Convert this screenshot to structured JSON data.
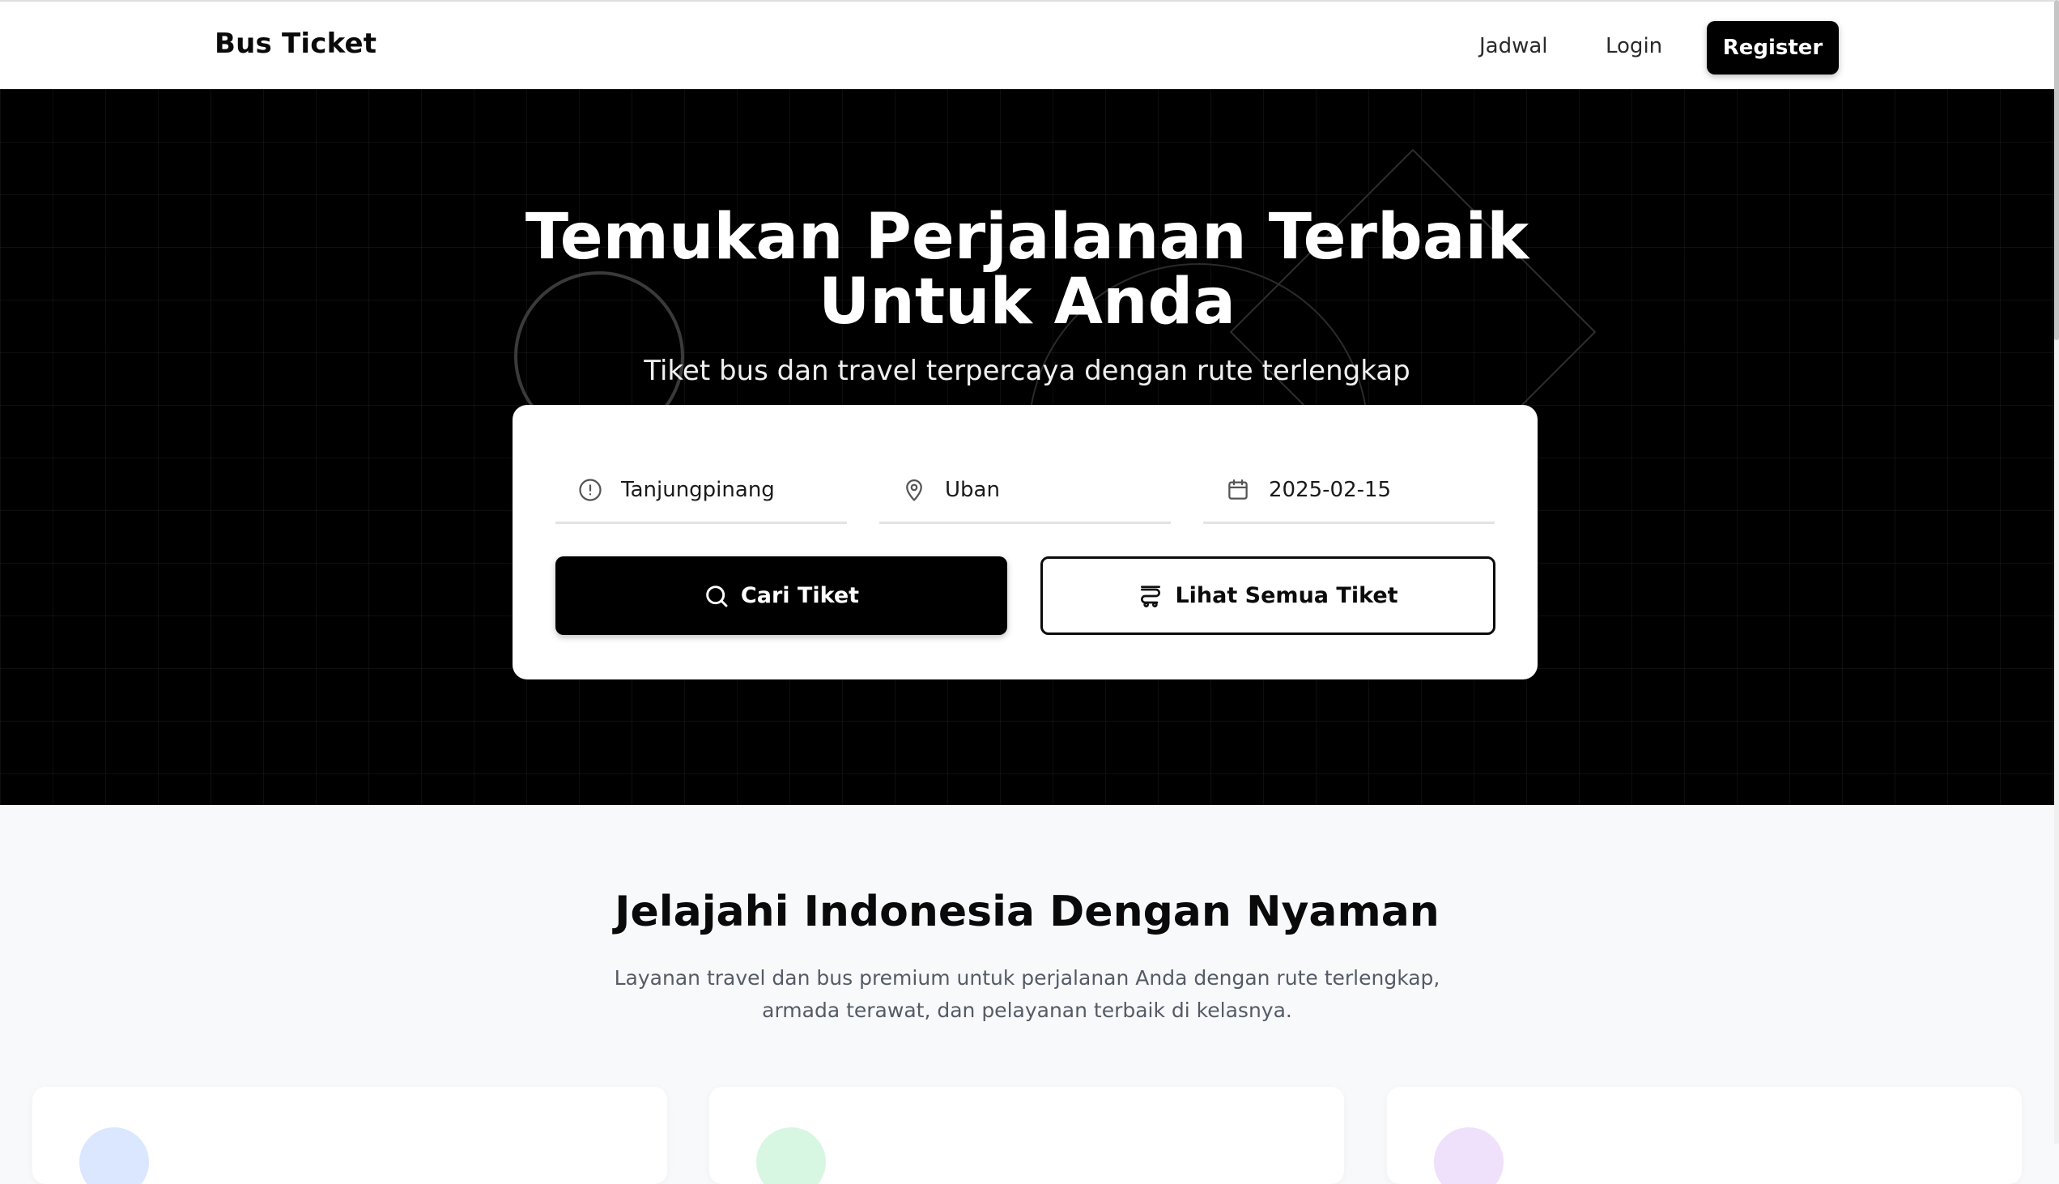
{
  "header": {
    "brand": "Bus Ticket",
    "nav": {
      "jadwal": "Jadwal",
      "login": "Login",
      "register": "Register"
    }
  },
  "hero": {
    "title_line1": "Temukan Perjalanan Terbaik",
    "title_line2": "Untuk Anda",
    "subtitle": "Tiket bus dan travel terpercaya dengan rute terlengkap"
  },
  "search": {
    "from": {
      "value": "Tanjungpinang",
      "icon": "alert-circle-icon"
    },
    "to": {
      "value": "Uban",
      "icon": "map-pin-icon"
    },
    "date": {
      "value": "2025-02-15",
      "icon": "calendar-icon"
    },
    "search_button": "Cari Tiket",
    "search_button_icon": "search-icon",
    "all_button": "Lihat Semua Tiket",
    "all_button_icon": "bus-icon"
  },
  "section": {
    "title": "Jelajahi Indonesia Dengan Nyaman",
    "description": "Layanan travel dan bus premium untuk perjalanan Anda dengan rute terlengkap, armada terawat, dan pelayanan terbaik di kelasnya.",
    "cards": [
      {
        "accent": "#dbe6ff"
      },
      {
        "accent": "#d8f7e2"
      },
      {
        "accent": "#efe0fb"
      }
    ]
  },
  "colors": {
    "primary": "#000000",
    "hero_background": "#000000",
    "section_background": "#f8f9fb"
  }
}
